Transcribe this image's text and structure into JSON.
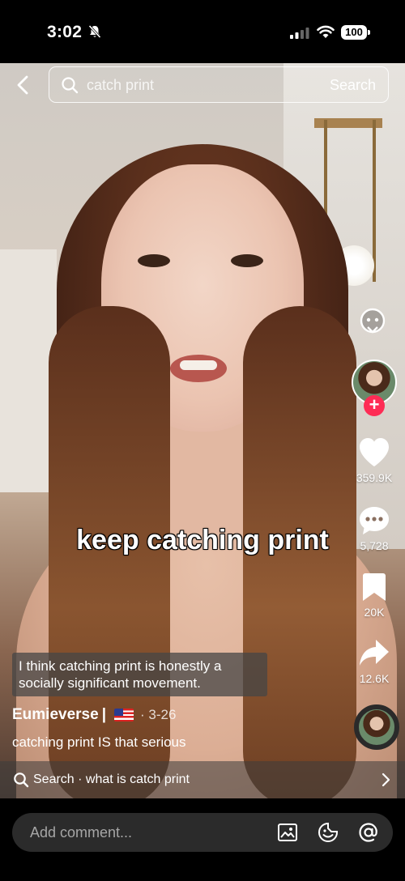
{
  "status_bar": {
    "time": "3:02",
    "battery": "100",
    "icons": [
      "bell-slash-icon",
      "signal-icon",
      "wifi-icon",
      "battery-icon"
    ]
  },
  "search": {
    "query": "catch print",
    "button_label": "Search"
  },
  "video": {
    "overlay_caption": "keep catching print",
    "sticker_text": "I think catching print is honestly a socially significant movement."
  },
  "actions": {
    "likes": "359.9K",
    "comments": "5,728",
    "saves": "20K",
    "shares": "12.6K"
  },
  "post": {
    "author": "Eumieverse",
    "author_separator": "|",
    "date": "· 3-26",
    "description": "catching print IS that serious"
  },
  "related_search": {
    "text": "Search · what is catch print"
  },
  "comment_bar": {
    "placeholder": "Add comment..."
  },
  "colors": {
    "follow_accent": "#fe2c55",
    "comment_box": "#2b2b2b"
  }
}
